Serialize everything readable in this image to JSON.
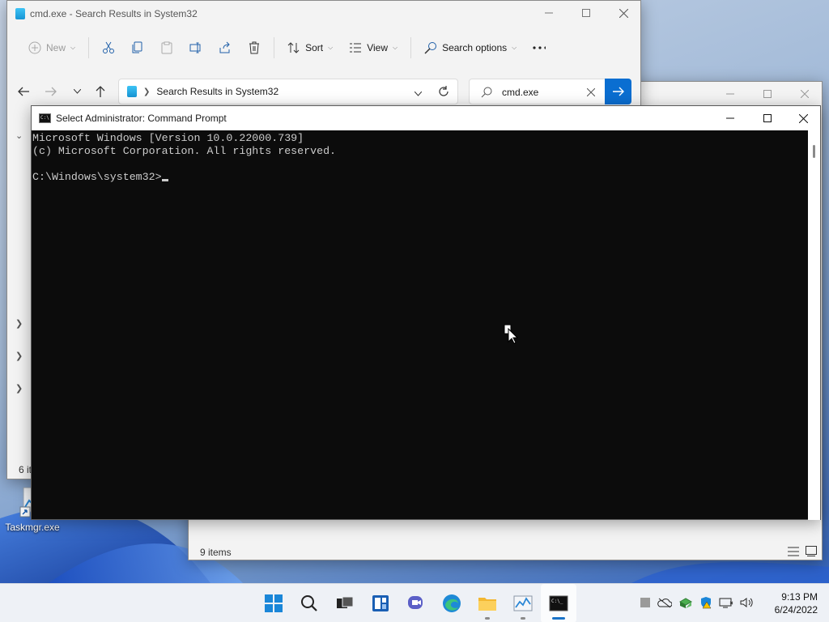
{
  "desktop": {
    "icon_label": "Taskmgr.exe"
  },
  "explorer_front": {
    "title": "cmd.exe - Search Results in System32",
    "toolbar": {
      "new_label": "New",
      "sort_label": "Sort",
      "view_label": "View",
      "search_options_label": "Search options"
    },
    "address": "Search Results in System32",
    "search_value": "cmd.exe",
    "status_partial": "6 it"
  },
  "explorer_back": {
    "status": "9 items"
  },
  "cmd": {
    "title": "Select Administrator: Command Prompt",
    "lines": [
      "Microsoft Windows [Version 10.0.22000.739]",
      "(c) Microsoft Corporation. All rights reserved.",
      "",
      "C:\\Windows\\system32>"
    ]
  },
  "taskbar": {
    "apps": [
      "start-icon",
      "search-icon",
      "task-view-icon",
      "widgets-icon",
      "chat-icon",
      "edge-icon",
      "file-explorer-icon",
      "task-manager-icon",
      "command-prompt-icon"
    ],
    "time": "9:13 PM",
    "date": "6/24/2022"
  },
  "colors": {
    "accent": "#0a6ed1",
    "console_bg": "#0c0c0c",
    "console_fg": "#cccccc"
  }
}
